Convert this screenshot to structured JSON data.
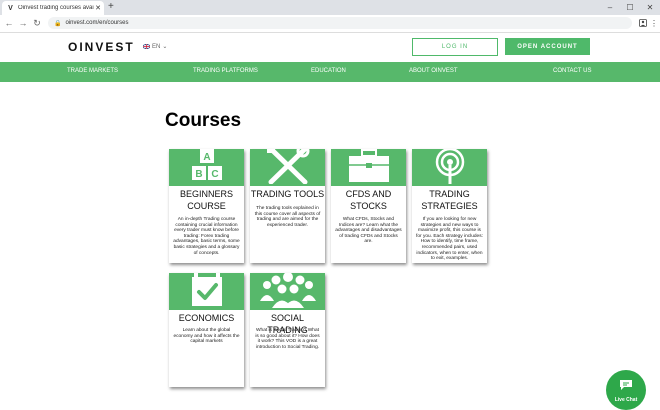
{
  "browser": {
    "tab_title": "Oinvest trading courses availab...",
    "tab_favicon": "V",
    "url": "oinvest.com/en/courses"
  },
  "header": {
    "logo": "OINVEST",
    "lang": "EN",
    "login": "LOG IN",
    "open_account": "OPEN ACCOUNT"
  },
  "nav": [
    "TRADE MARKETS",
    "TRADING PLATFORMS",
    "EDUCATION",
    "ABOUT OINVEST",
    "CONTACT US"
  ],
  "page_title": "Courses",
  "cards": [
    {
      "icon": "abc-blocks-icon",
      "title_lines": [
        "BEGINNERS",
        "COURSE"
      ],
      "desc": "An in-depth Trading course containing crucial information every trader must know before trading: Forex trading advantages, basic terms, some basic strategies and a glossary of concepts."
    },
    {
      "icon": "tools-icon",
      "title_lines": [
        "TRADING TOOLS"
      ],
      "desc": "The trading tools explained in this course cover all aspects of trading and are aimed for the experienced trader."
    },
    {
      "icon": "briefcase-icon",
      "title_lines": [
        "CFDS AND",
        "STOCKS"
      ],
      "desc": "What CFDs, Stocks and Indices are? Learn what the advantages and disadvantages of trading CFDs and Stocks are."
    },
    {
      "icon": "target-icon",
      "title_lines": [
        "TRADING",
        "STRATEGIES"
      ],
      "desc": "If you are looking for new strategies and new ways to maximize profit, this course is for you. Each strategy includes: How to identify, time frame, recommended pairs, used indicators, when to enter, when to exit, examples."
    },
    {
      "icon": "calendar-check-icon",
      "title_lines": [
        "ECONOMICS"
      ],
      "desc": "Learn about the global economy and how it affects the capital markets"
    },
    {
      "icon": "people-group-icon",
      "title_lines": [
        "SOCIAL TRADING"
      ],
      "desc": "What is Social Trading? What is so good about it? How does it work? This VOD is a great introduction to Social Trading."
    }
  ],
  "chat": {
    "label": "Live Chat"
  },
  "colors": {
    "brand_green": "#57b86b",
    "chat_green": "#2ea84a"
  }
}
